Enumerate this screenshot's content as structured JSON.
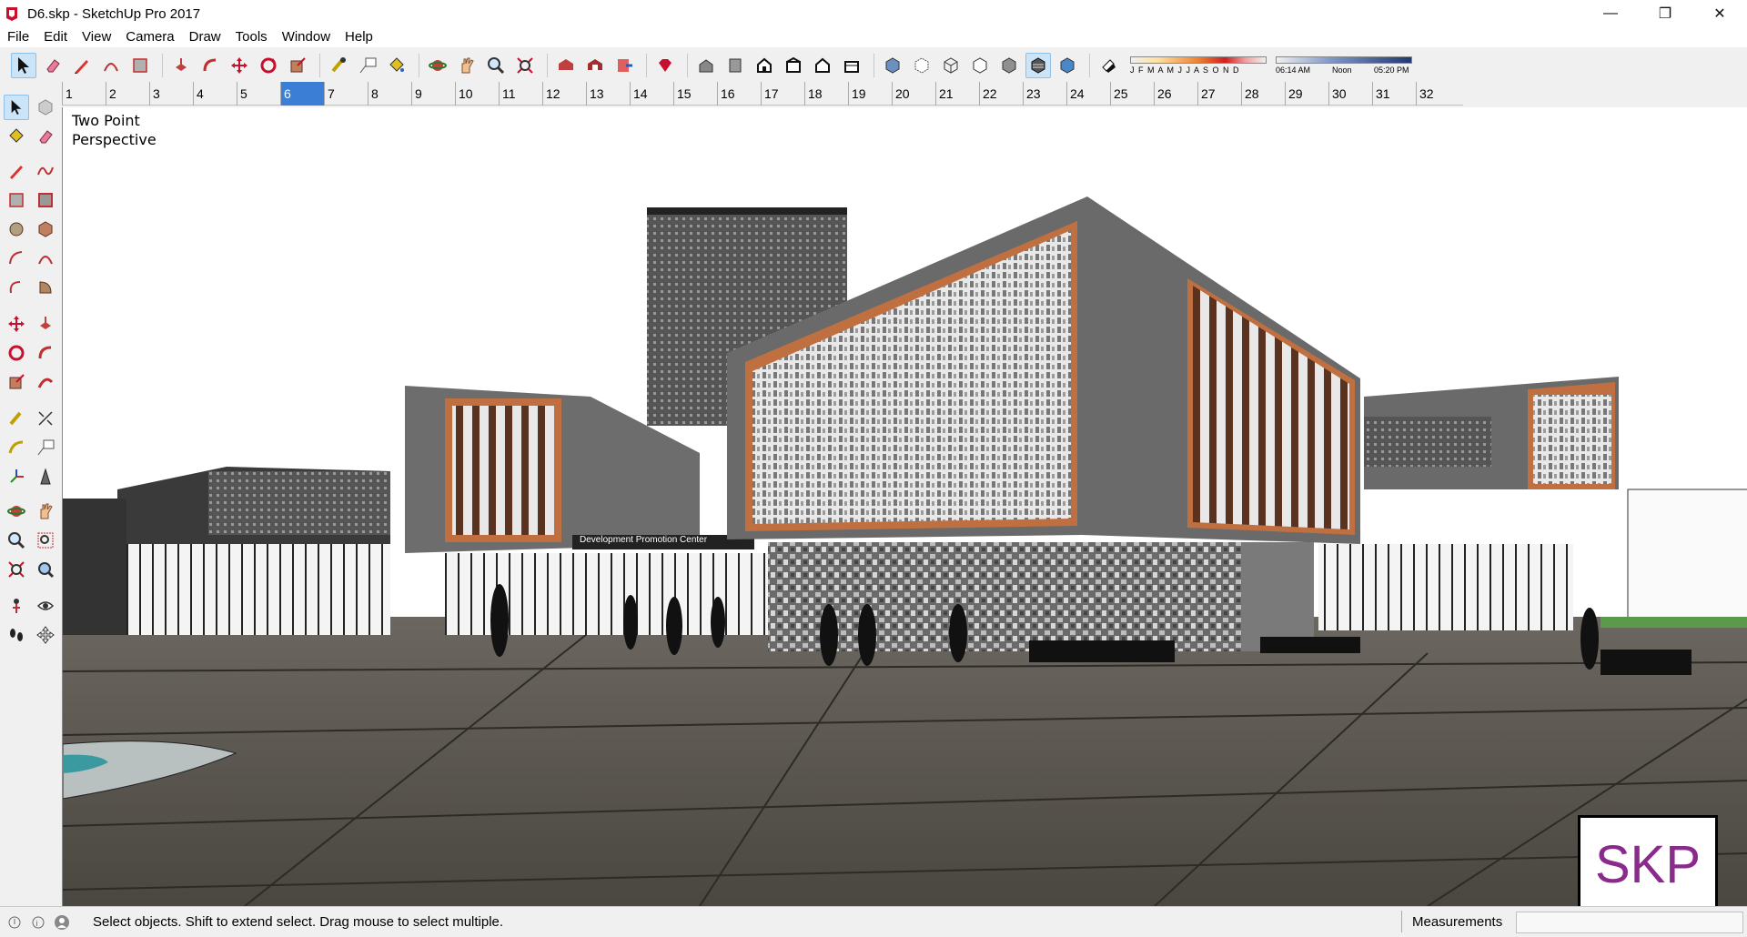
{
  "window": {
    "title": "D6.skp - SketchUp Pro 2017",
    "minimize": "—",
    "restore": "❐",
    "close": "✕"
  },
  "menu": [
    "File",
    "Edit",
    "View",
    "Camera",
    "Draw",
    "Tools",
    "Window",
    "Help"
  ],
  "toolbar": {
    "shadow_months_label": "J F M A M J J A S O N D",
    "shadow_time_start": "06:14 AM",
    "shadow_time_mid": "Noon",
    "shadow_time_end": "05:20 PM"
  },
  "scene_tabs": [
    "1",
    "2",
    "3",
    "4",
    "5",
    "6",
    "7",
    "8",
    "9",
    "10",
    "11",
    "12",
    "13",
    "14",
    "15",
    "16",
    "17",
    "18",
    "19",
    "20",
    "21",
    "22",
    "23",
    "24",
    "25",
    "26",
    "27",
    "28",
    "29",
    "30",
    "31",
    "32"
  ],
  "active_scene": "6",
  "viewport": {
    "camera_label_line1": "Two Point",
    "camera_label_line2": "Perspective",
    "building_sign": "Development Promotion Center",
    "watermark": "SKP"
  },
  "status": {
    "message": "Select objects. Shift to extend select. Drag mouse to select multiple.",
    "measurements_label": "Measurements",
    "measurements_value": ""
  },
  "colors": {
    "accent": "#3a7fd5",
    "sketchup_red": "#c8102e",
    "watermark_purple": "#8a2a8a"
  }
}
